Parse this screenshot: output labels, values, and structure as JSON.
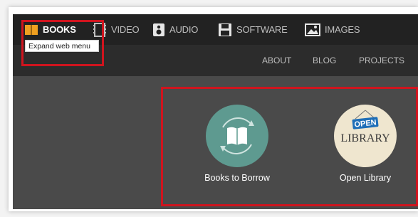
{
  "media_nav": {
    "items": [
      {
        "label": "BOOKS",
        "icon": "book-icon"
      },
      {
        "label": "VIDEO",
        "icon": "film-icon"
      },
      {
        "label": "AUDIO",
        "icon": "speaker-icon"
      },
      {
        "label": "SOFTWARE",
        "icon": "floppy-disk-icon"
      },
      {
        "label": "IMAGES",
        "icon": "image-icon"
      }
    ]
  },
  "tooltip": "Expand web menu",
  "top_links": [
    "ABOUT",
    "BLOG",
    "PROJECTS"
  ],
  "tiles": [
    {
      "caption": "Books to Borrow",
      "icon": "open-book-icon"
    },
    {
      "caption": "Open Library",
      "logo_sign": "OPEN",
      "logo_word": "LIBRARY"
    }
  ],
  "colors": {
    "highlight": "#d0141e",
    "books_icon": "#f0a020",
    "topbar": "#222222",
    "subbar": "#2c2c2c",
    "main_bg": "#4a4a4a",
    "books_to_borrow_circle": "#5e9a90",
    "open_library_circle": "#efe6cf",
    "open_library_sign": "#1f6fb8"
  }
}
